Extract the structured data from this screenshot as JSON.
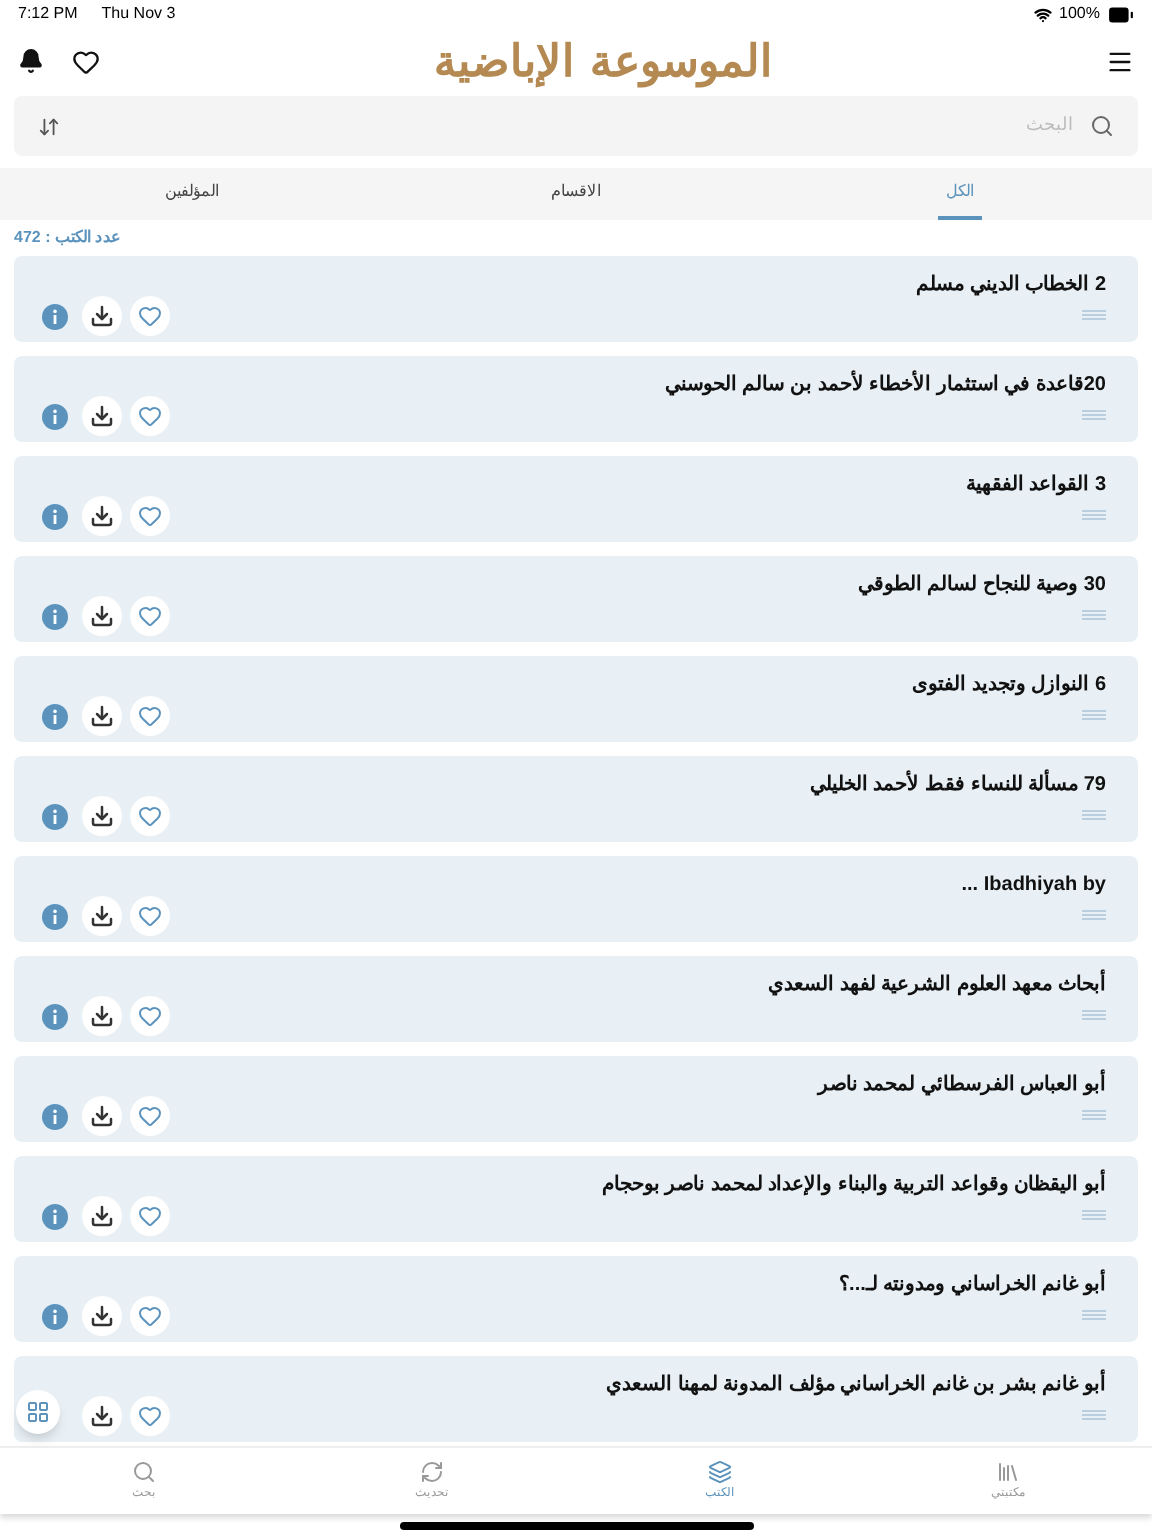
{
  "status_bar": {
    "time": "7:12 PM",
    "date": "Thu Nov 3",
    "battery": "100%"
  },
  "header": {
    "logo": "الموسوعة الإباضية"
  },
  "search": {
    "placeholder": "البحث"
  },
  "tabs": [
    {
      "label": "الكل",
      "selected": true
    },
    {
      "label": "الاقسام",
      "selected": false
    },
    {
      "label": "المؤلفين",
      "selected": false
    }
  ],
  "book_count": "عدد الكتب : 472",
  "books": [
    {
      "title": "2 الخطاب الديني مسلم",
      "info_button": true
    },
    {
      "title": "20قاعدة في استثمار الأخطاء لأحمد بن سالم الحوسني",
      "info_button": true
    },
    {
      "title": "3 القواعد الفقهية",
      "info_button": true
    },
    {
      "title": "30 وصية للنجاح لسالم الطوقي",
      "info_button": true
    },
    {
      "title": "6 النوازل وتجديد الفتوى",
      "info_button": true
    },
    {
      "title": "79 مسألة للنساء فقط لأحمد الخليلي",
      "info_button": true
    },
    {
      "title": "Ibadhiyah by ...",
      "info_button": true
    },
    {
      "title": "أبحاث معهد العلوم الشرعية لفهد السعدي",
      "info_button": true
    },
    {
      "title": "أبو العباس الفرسطائي لمحمد ناصر",
      "info_button": true
    },
    {
      "title": "أبو اليقظان وقواعد التربية والبناء والإعداد لمحمد ناصر بوحجام",
      "info_button": true
    },
    {
      "title": "أبو غانم الخراساني ومدونته لـ...؟",
      "info_button": true
    },
    {
      "title": "أبو غانم بشر بن غانم الخراساني مؤلف المدونة لمهنا السعدي",
      "info_button": false
    }
  ],
  "bottom_tabs": [
    {
      "label": "مكتبتي",
      "kind": "library",
      "selected": false
    },
    {
      "label": "الكتب",
      "kind": "books",
      "selected": true
    },
    {
      "label": "تحديث",
      "kind": "refresh",
      "selected": false
    },
    {
      "label": "بحث",
      "kind": "search",
      "selected": false
    }
  ]
}
